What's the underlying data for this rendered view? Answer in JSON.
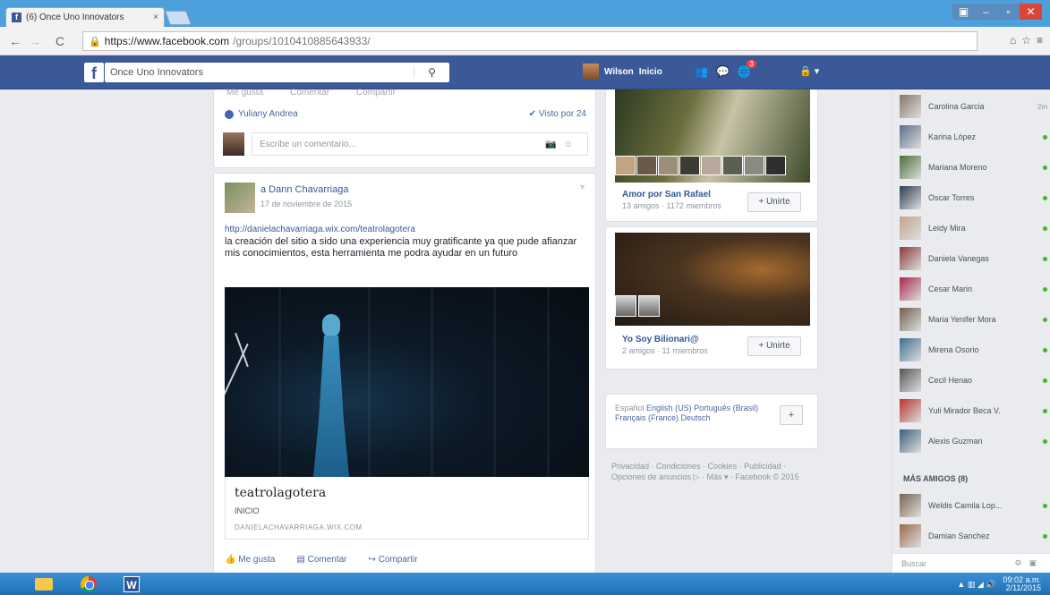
{
  "browser": {
    "tab_title": "(6) Once Uno Innovators",
    "tab_close": "×",
    "url_host": "https://www.facebook.com",
    "url_path": "/groups/1010410885643933/"
  },
  "fb_header": {
    "logo": "f",
    "search_value": "Once Uno Innovators",
    "user_name": "Wilson",
    "home_label": "Inicio",
    "notif_count": "3"
  },
  "post_top": {
    "actions": [
      "Me gusta",
      "Comentar",
      "Compartir"
    ],
    "liker": "Yuliany Andrea",
    "seen": "✔ Visto por 24",
    "comment_placeholder": "Escribe un comentario..."
  },
  "post_main": {
    "author": "a Dann Chavarriaga",
    "date": "17 de noviembre de 2015",
    "link": "http://danielachavarriaga.wix.com/teatrolagotera",
    "text": "la creación del sitio a sido una experiencia muy gratificante ya que pude afianzar mis conocimientos, esta herramienta me podra ayudar en un futuro",
    "preview_title": "teatrolagotera",
    "preview_sub": "INICIO",
    "preview_domain": "DANIELACHAVARRIAGA.WIX.COM",
    "actions": [
      "Me gusta",
      "Comentar",
      "Compartir"
    ]
  },
  "groups": [
    {
      "name": "Amor por San Rafael",
      "meta": "13 amigos · 1172 miembros",
      "join": "+ Unirte"
    },
    {
      "name": "Yo Soy Bilionari@",
      "meta": "2 amigos · 11 miembros",
      "join": "+ Unirte"
    }
  ],
  "languages": {
    "current": "Español",
    "others": "English (US)  Português (Brasil)  Français (France)  Deutsch",
    "plus": "+"
  },
  "footer": "Privacidad · Condiciones · Cookies · Publicidad · Opciones de anuncios ▷ · Más ▾ · Facebook © 2015",
  "chat": {
    "friends": [
      {
        "name": "Carolina Garcia",
        "status": "2m",
        "color": "#8a7868"
      },
      {
        "name": "Karina López",
        "status": "online",
        "color": "#5c6e8a"
      },
      {
        "name": "Mariana Moreno",
        "status": "online",
        "color": "#4a6e3a"
      },
      {
        "name": "Oscar Torres",
        "status": "online",
        "color": "#2c3e50"
      },
      {
        "name": "Leidy Mira",
        "status": "online",
        "color": "#c2a48a"
      },
      {
        "name": "Daniela Vanegas",
        "status": "online",
        "color": "#8b3a3a"
      },
      {
        "name": "Cesar Marin",
        "status": "online",
        "color": "#a82a4a"
      },
      {
        "name": "Maria Yenifer Mora",
        "status": "online",
        "color": "#6f5e4e"
      },
      {
        "name": "Mirena Osorio",
        "status": "online",
        "color": "#3e6f8f"
      },
      {
        "name": "Cecil Henao",
        "status": "online",
        "color": "#555"
      },
      {
        "name": "Yuli Mirador Beca V.",
        "status": "online",
        "color": "#b8332e"
      },
      {
        "name": "Alexis Guzman",
        "status": "online",
        "color": "#3a5f7a"
      }
    ],
    "more_label": "MÁS AMIGOS (8)",
    "more": [
      {
        "name": "Weldis Camila Lop...",
        "status": "online",
        "color": "#7a6350"
      },
      {
        "name": "Damian Sanchez",
        "status": "online",
        "color": "#9a6b4a"
      }
    ],
    "search_placeholder": "Buscar"
  },
  "taskbar": {
    "word_label": "W",
    "time": "09:02 a.m.",
    "date": "2/11/2015"
  }
}
